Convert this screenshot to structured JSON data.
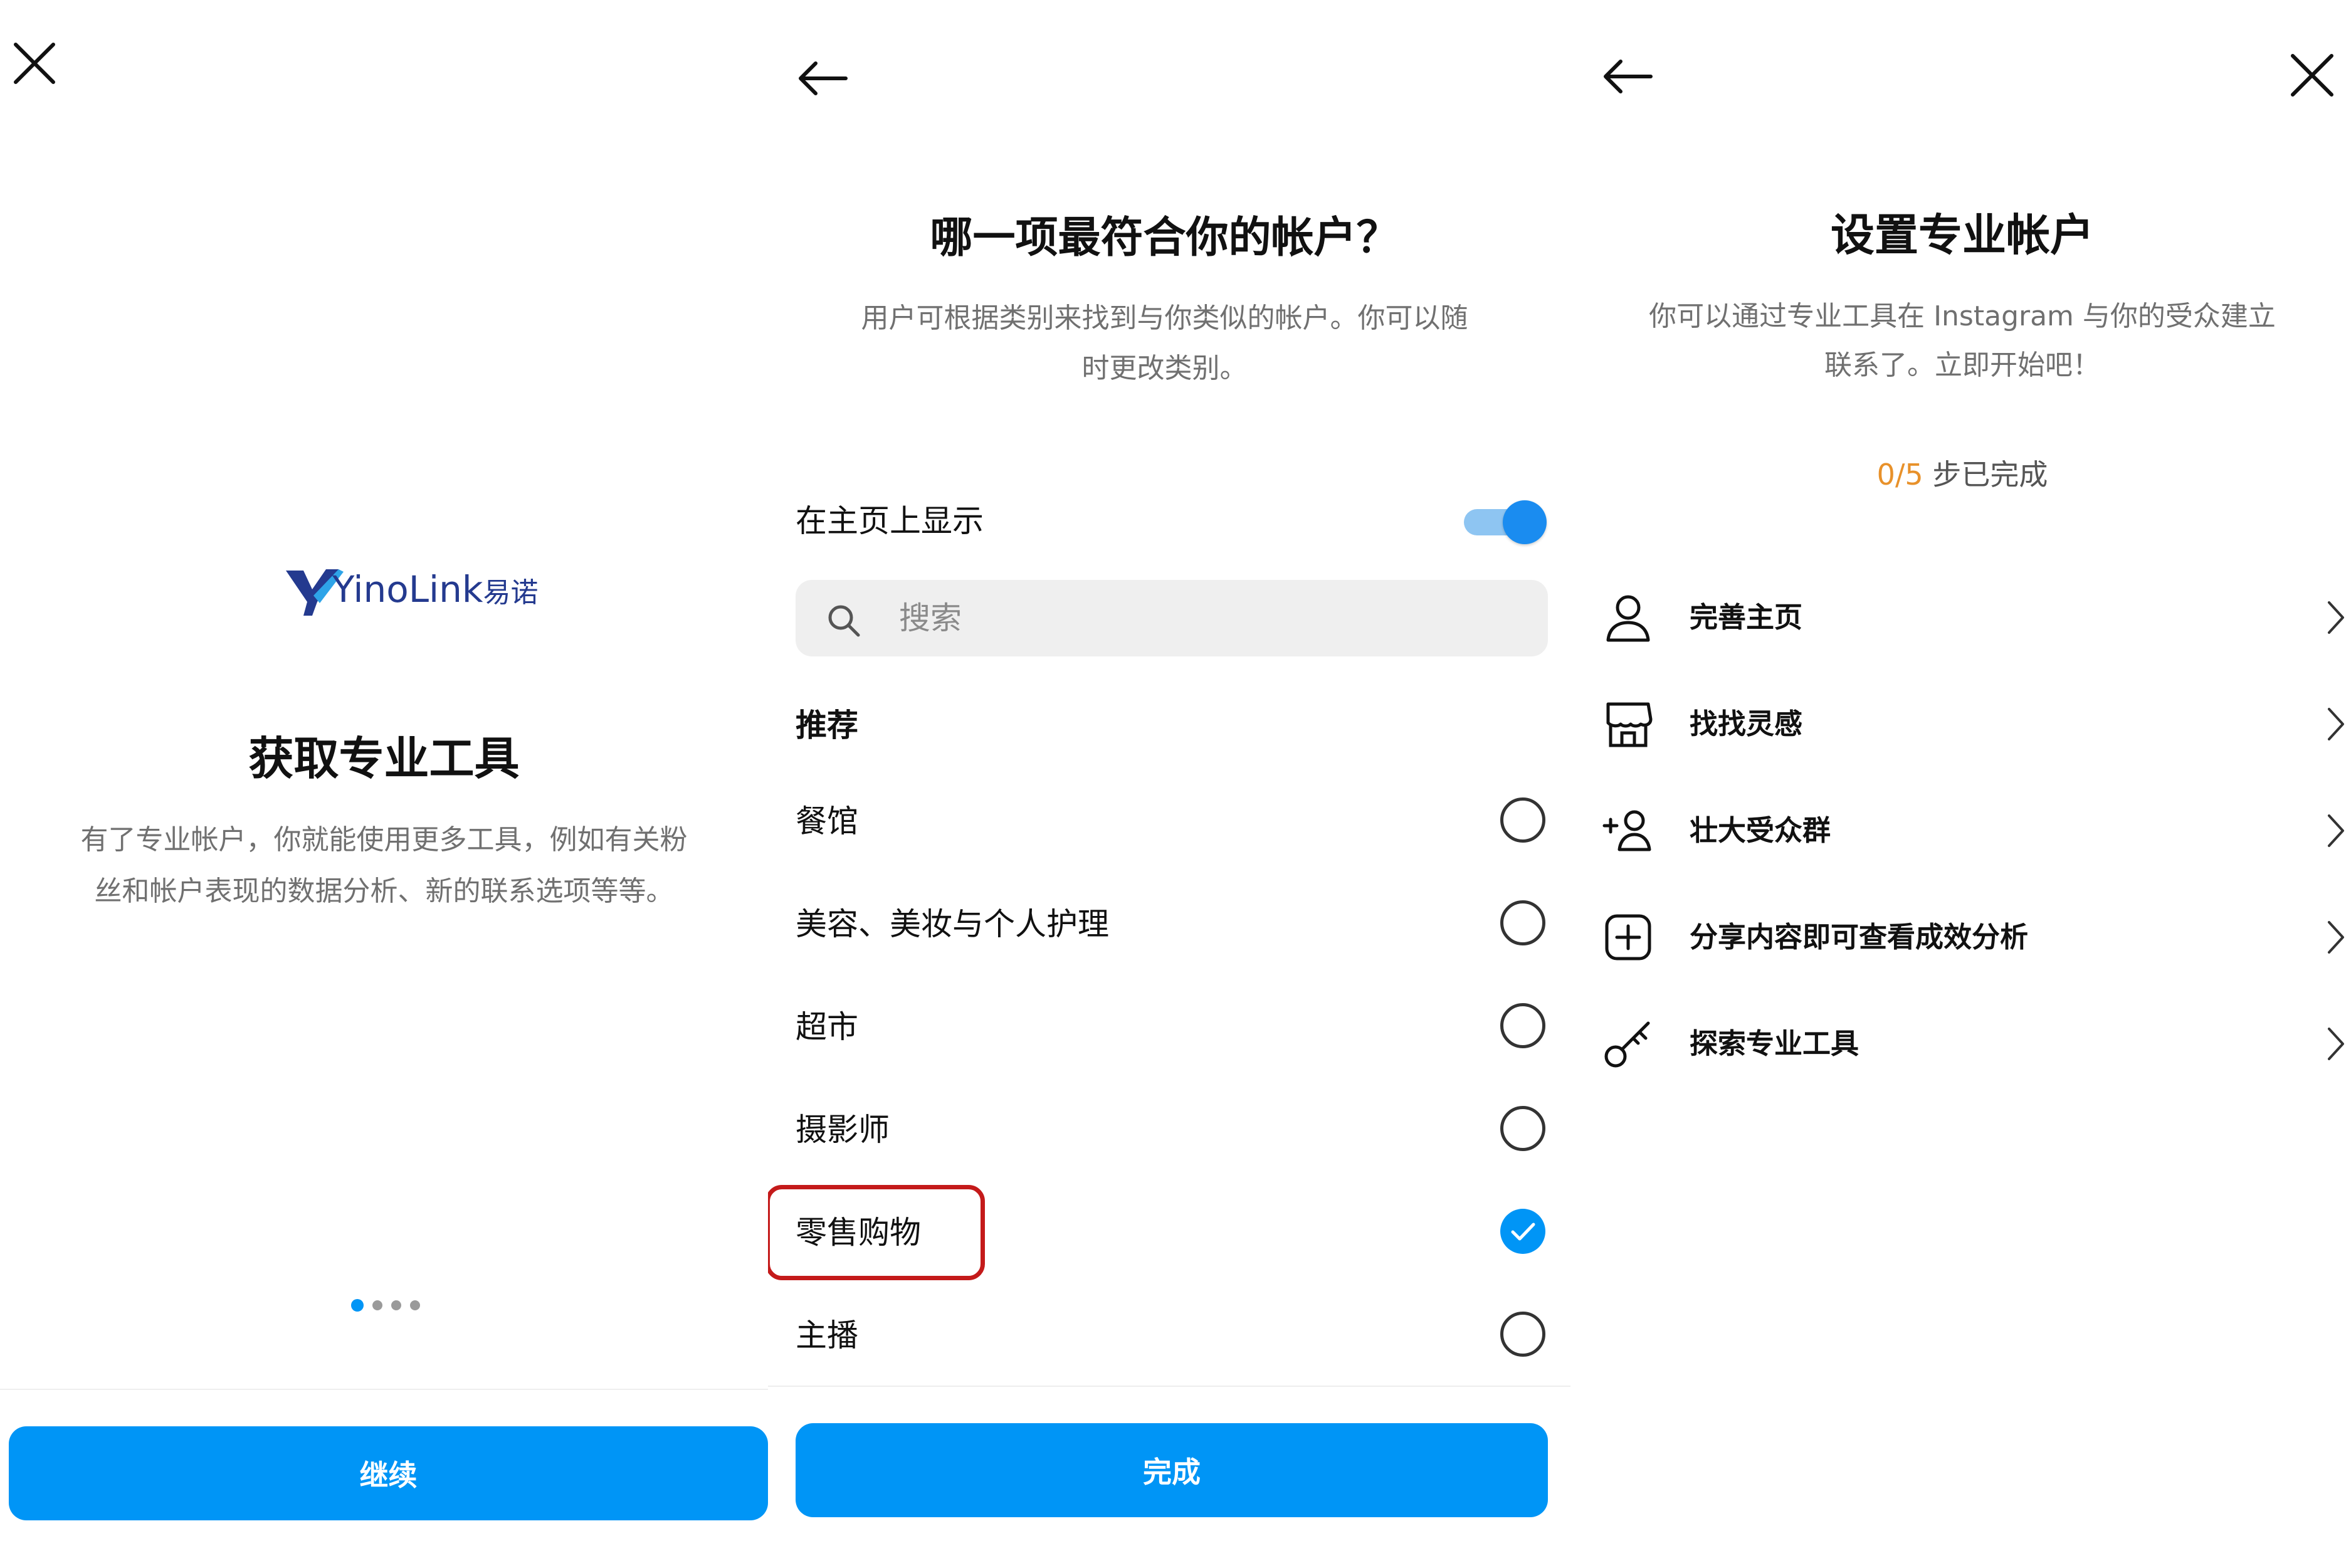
{
  "screen1": {
    "close_icon": "close-icon",
    "logo": {
      "brand": "YinoLink",
      "brand_cn": "易诺"
    },
    "title": "获取专业工具",
    "description_line1": "有了专业帐户，你就能使用更多工具，例如有关粉",
    "description_line2": "丝和帐户表现的数据分析、新的联系选项等等。",
    "pagination": {
      "count": 4,
      "active": 1
    },
    "continue_label": "继续"
  },
  "screen2": {
    "back_icon": "back-arrow-icon",
    "title": "哪一项最符合你的帐户？",
    "description_line1": "用户可根据类别来找到与你类似的帐户。你可以随",
    "description_line2": "时更改类别。",
    "show_on_profile_label": "在主页上显示",
    "show_on_profile_enabled": true,
    "search_placeholder": "搜索",
    "section_label": "推荐",
    "categories": [
      {
        "label": "餐馆",
        "selected": false
      },
      {
        "label": "美容、美妆与个人护理",
        "selected": false
      },
      {
        "label": "超市",
        "selected": false
      },
      {
        "label": "摄影师",
        "selected": false
      },
      {
        "label": "零售购物",
        "selected": true
      },
      {
        "label": "主播",
        "selected": false
      }
    ],
    "done_label": "完成",
    "highlight_color": "#c41a1a"
  },
  "screen3": {
    "back_icon": "back-arrow-icon",
    "close_icon": "close-icon",
    "title": "设置专业帐户",
    "description_line1": "你可以通过专业工具在 Instagram 与你的受众建立",
    "description_line2": "联系了。立即开始吧！",
    "progress_done": "0/5",
    "progress_suffix": " 步已完成",
    "progress_color": "#e8912a",
    "steps": [
      {
        "label": "完善主页",
        "icon": "person-icon"
      },
      {
        "label": "找找灵感",
        "icon": "shop-icon"
      },
      {
        "label": "壮大受众群",
        "icon": "add-person-icon"
      },
      {
        "label": "分享内容即可查看成效分析",
        "icon": "plus-square-icon"
      },
      {
        "label": "探索专业工具",
        "icon": "key-icon"
      }
    ]
  },
  "colors": {
    "accent": "#0095f6",
    "text": "#111111",
    "muted": "#707070"
  }
}
